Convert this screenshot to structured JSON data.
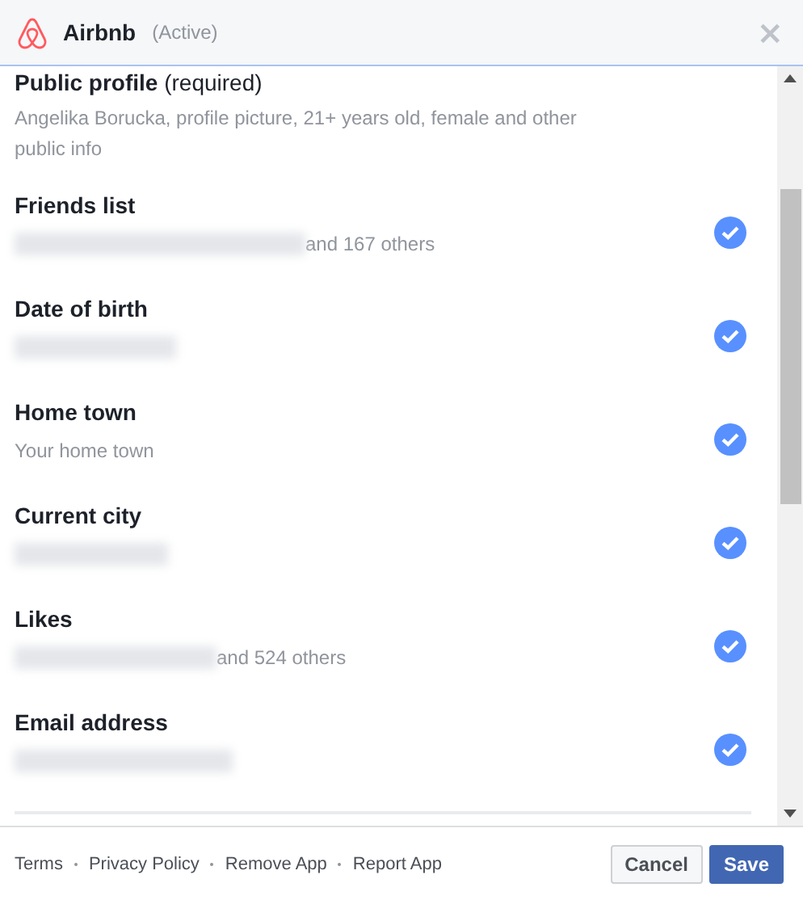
{
  "header": {
    "app_name": "Airbnb",
    "status": "(Active)",
    "close": "×"
  },
  "public_profile": {
    "title": "**Public profile** (required)",
    "detail": "Angelika Borucka, profile picture, 21+ years old, female and other public info"
  },
  "permissions": [
    {
      "title": "Friends list",
      "redacted": true,
      "detail": "and 167 others",
      "checked": true
    },
    {
      "title": "Date of birth",
      "redacted": true,
      "checked": true
    },
    {
      "title": "Home town",
      "redacted": false,
      "detail": "Your home town",
      "checked": true
    },
    {
      "title": "Current city",
      "redacted": true,
      "checked": true
    },
    {
      "title": "Likes",
      "redacted": true,
      "detail": "and 524 others",
      "checked": true
    },
    {
      "title": "Email address",
      "redacted": true,
      "checked": true
    }
  ],
  "footer_links": [
    "Terms",
    "Privacy Policy",
    "Remove App",
    "Report App"
  ],
  "buttons": [
    {
      "label": "Cancel",
      "kind": "secondary"
    },
    {
      "label": "Save",
      "kind": "primary"
    }
  ]
}
